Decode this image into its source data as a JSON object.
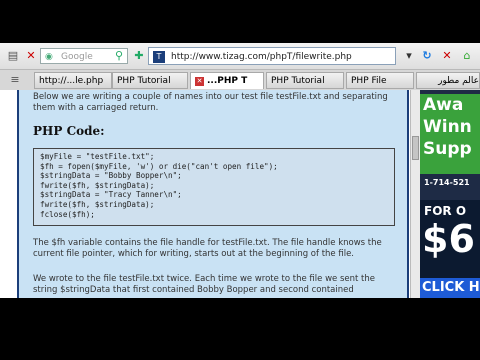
{
  "toolbar": {
    "search_placeholder": "Google",
    "url": "http://www.tizag.com/phpT/filewrite.php"
  },
  "tabs": [
    {
      "label": "http://...le.php"
    },
    {
      "label": "PHP Tutorial"
    },
    {
      "label": "...PHP T"
    },
    {
      "label": "PHP Tutorial"
    },
    {
      "label": "PHP File"
    },
    {
      "label": "عالم مطور"
    }
  ],
  "article": {
    "intro": "Below we are writing a couple of names into our test file testFile.txt and separating them with a carriaged return.",
    "code_heading": "PHP Code:",
    "code_lines": [
      "$myFile = \"testFile.txt\";",
      "$fh = fopen($myFile, 'w') or die(\"can't open file\");",
      "$stringData = \"Bobby Bopper\\n\";",
      "fwrite($fh, $stringData);",
      "$stringData = \"Tracy Tanner\\n\";",
      "fwrite($fh, $stringData);",
      "fclose($fh);"
    ],
    "para2": "The $fh variable contains the file handle for testFile.txt. The file handle knows the current file pointer, which for writing, starts out at the beginning of the file.",
    "para3": "We wrote to the file testFile.txt twice. Each time we wrote to the file we sent the string $stringData that first contained Bobby Bopper and second contained"
  },
  "ad": {
    "line1": "Awa",
    "line2": "Winn",
    "line3": "Supp",
    "phone": "1-714-521",
    "for_text": "FOR O",
    "price": "$6",
    "click": "CLICK H"
  }
}
